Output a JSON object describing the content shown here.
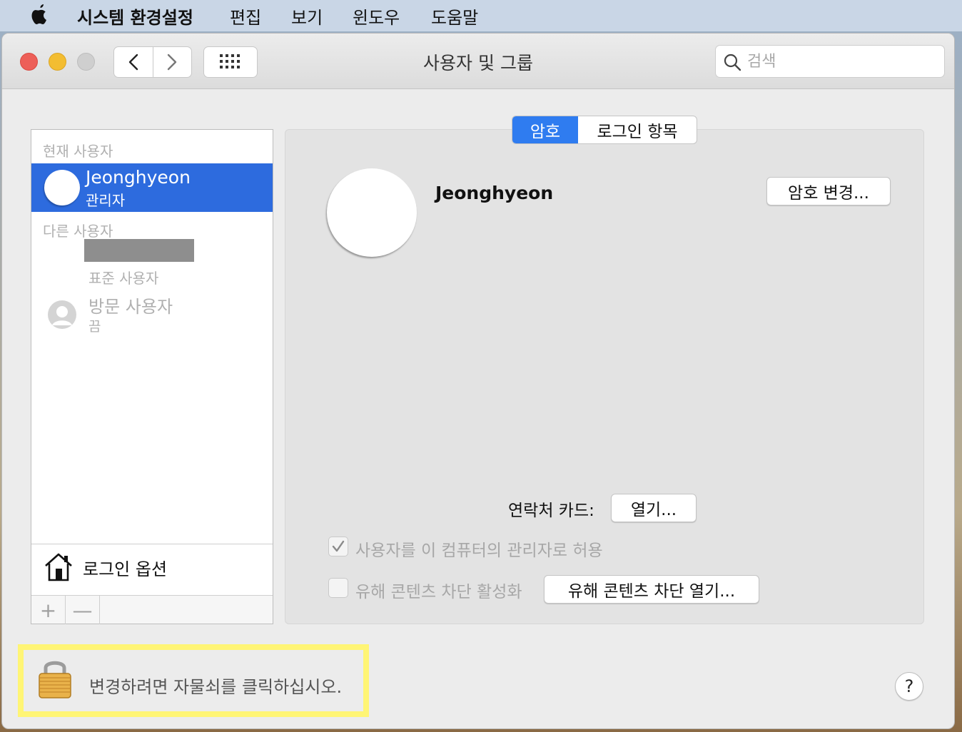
{
  "menubar": {
    "app_name": "시스템 환경설정",
    "items": [
      "편집",
      "보기",
      "윈도우",
      "도움말"
    ]
  },
  "window": {
    "title": "사용자 및 그룹",
    "search_placeholder": "검색"
  },
  "sidebar": {
    "current_users_header": "현재 사용자",
    "current_user": {
      "name": "Jeonghyeon",
      "role": "관리자"
    },
    "other_users_header": "다른 사용자",
    "other_user_role": "표준 사용자",
    "guest": {
      "name": "방문 사용자",
      "status": "끔"
    },
    "login_options": "로그인 옵션",
    "add_label": "+",
    "remove_label": "—"
  },
  "panel": {
    "tabs": [
      {
        "label": "암호",
        "active": true
      },
      {
        "label": "로그인 항목",
        "active": false
      }
    ],
    "user_name": "Jeonghyeon",
    "change_password_button": "암호 변경...",
    "contact_card_label": "연락처 카드:",
    "open_button": "열기...",
    "allow_admin_label": "사용자를 이 컴퓨터의 관리자로 허용",
    "allow_admin_checked": true,
    "parental_label": "유해 콘텐츠 차단 활성화",
    "parental_checked": false,
    "parental_open_button": "유해 콘텐츠 차단 열기..."
  },
  "footer": {
    "lock_text": "변경하려면 자물쇠를 클릭하십시오.",
    "help_label": "?"
  },
  "colors": {
    "accent": "#2d6bde",
    "tab_active": "#2f7cf0",
    "highlight": "#fff575"
  }
}
